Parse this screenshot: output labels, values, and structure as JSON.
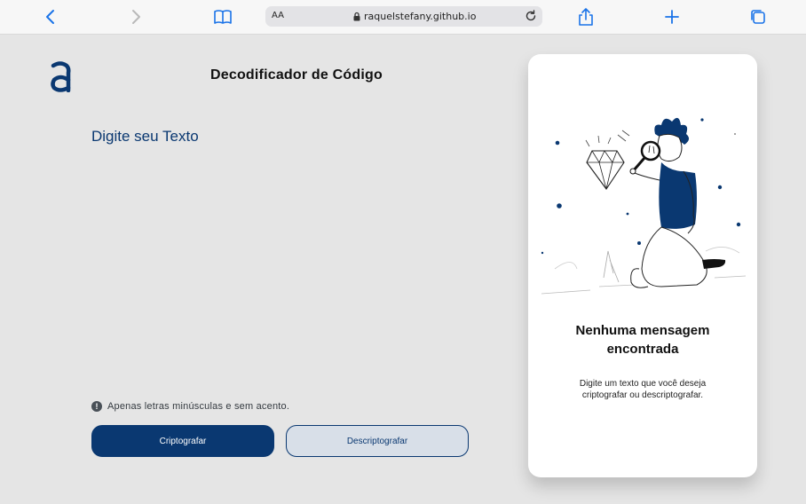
{
  "browser": {
    "url_text_size": "AA",
    "url": "raquelstefany.github.io",
    "icons": [
      "chevron-left-icon",
      "chevron-right-icon",
      "book-icon",
      "lock-icon",
      "reload-icon",
      "share-icon",
      "plus-icon",
      "tabs-icon"
    ]
  },
  "header": {
    "title": "Decodificador de Código",
    "logo_icon": "alura-a-logo"
  },
  "input": {
    "placeholder": "Digite seu Texto",
    "value": ""
  },
  "hint": {
    "icon": "exclamation-icon",
    "text": "Apenas letras minúsculas e sem acento."
  },
  "buttons": {
    "encrypt_label": "Criptografar",
    "decrypt_label": "Descriptografar"
  },
  "output": {
    "illustration": "person-with-magnifying-glass-and-diamond",
    "title": "Nenhuma mensagem encontrada",
    "text": "Digite um texto que você deseja criptografar ou descriptografar."
  },
  "colors": {
    "primary": "#0a3871",
    "background": "#e5e5e5",
    "panel": "#ffffff",
    "secondary_button": "#d8dfe8"
  }
}
